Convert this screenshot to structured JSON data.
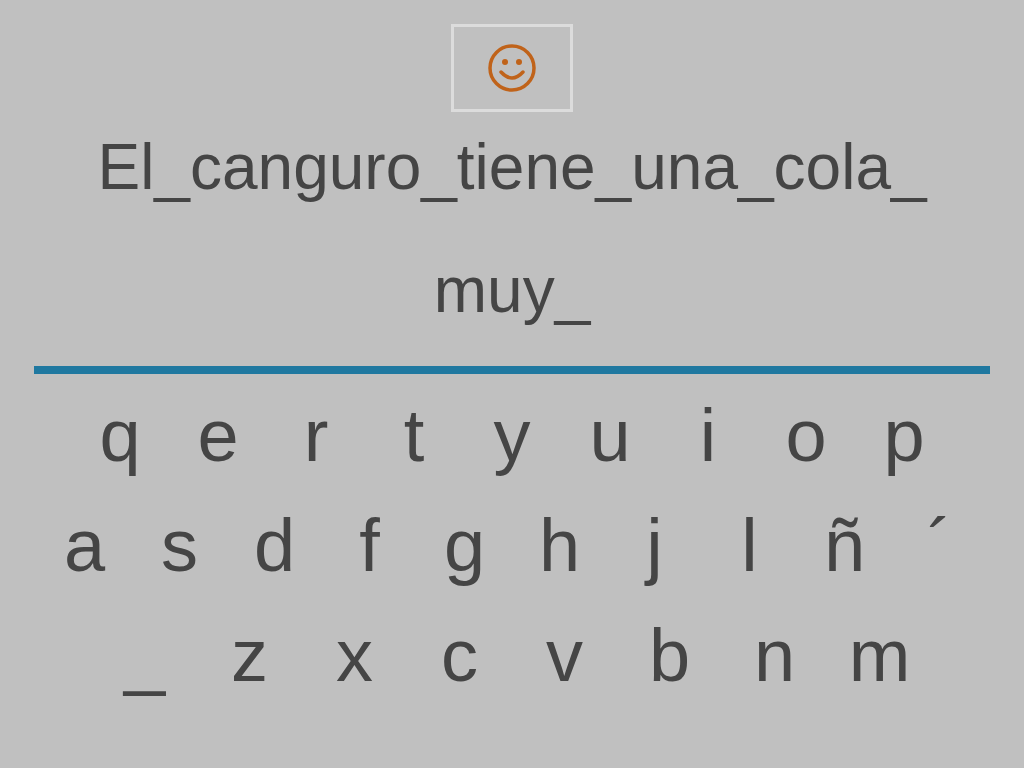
{
  "sentence_lines": [
    "El_canguro_tiene_una_cola_",
    "muy_"
  ],
  "keyboard": {
    "rows": [
      [
        "q",
        "e",
        "r",
        "t",
        "y",
        "u",
        "i",
        "o",
        "p"
      ],
      [
        "a",
        "s",
        "d",
        "f",
        "g",
        "h",
        "j",
        "l",
        "ñ",
        "´"
      ],
      [
        "_",
        "z",
        "x",
        "c",
        "v",
        "b",
        "n",
        "m"
      ]
    ]
  }
}
